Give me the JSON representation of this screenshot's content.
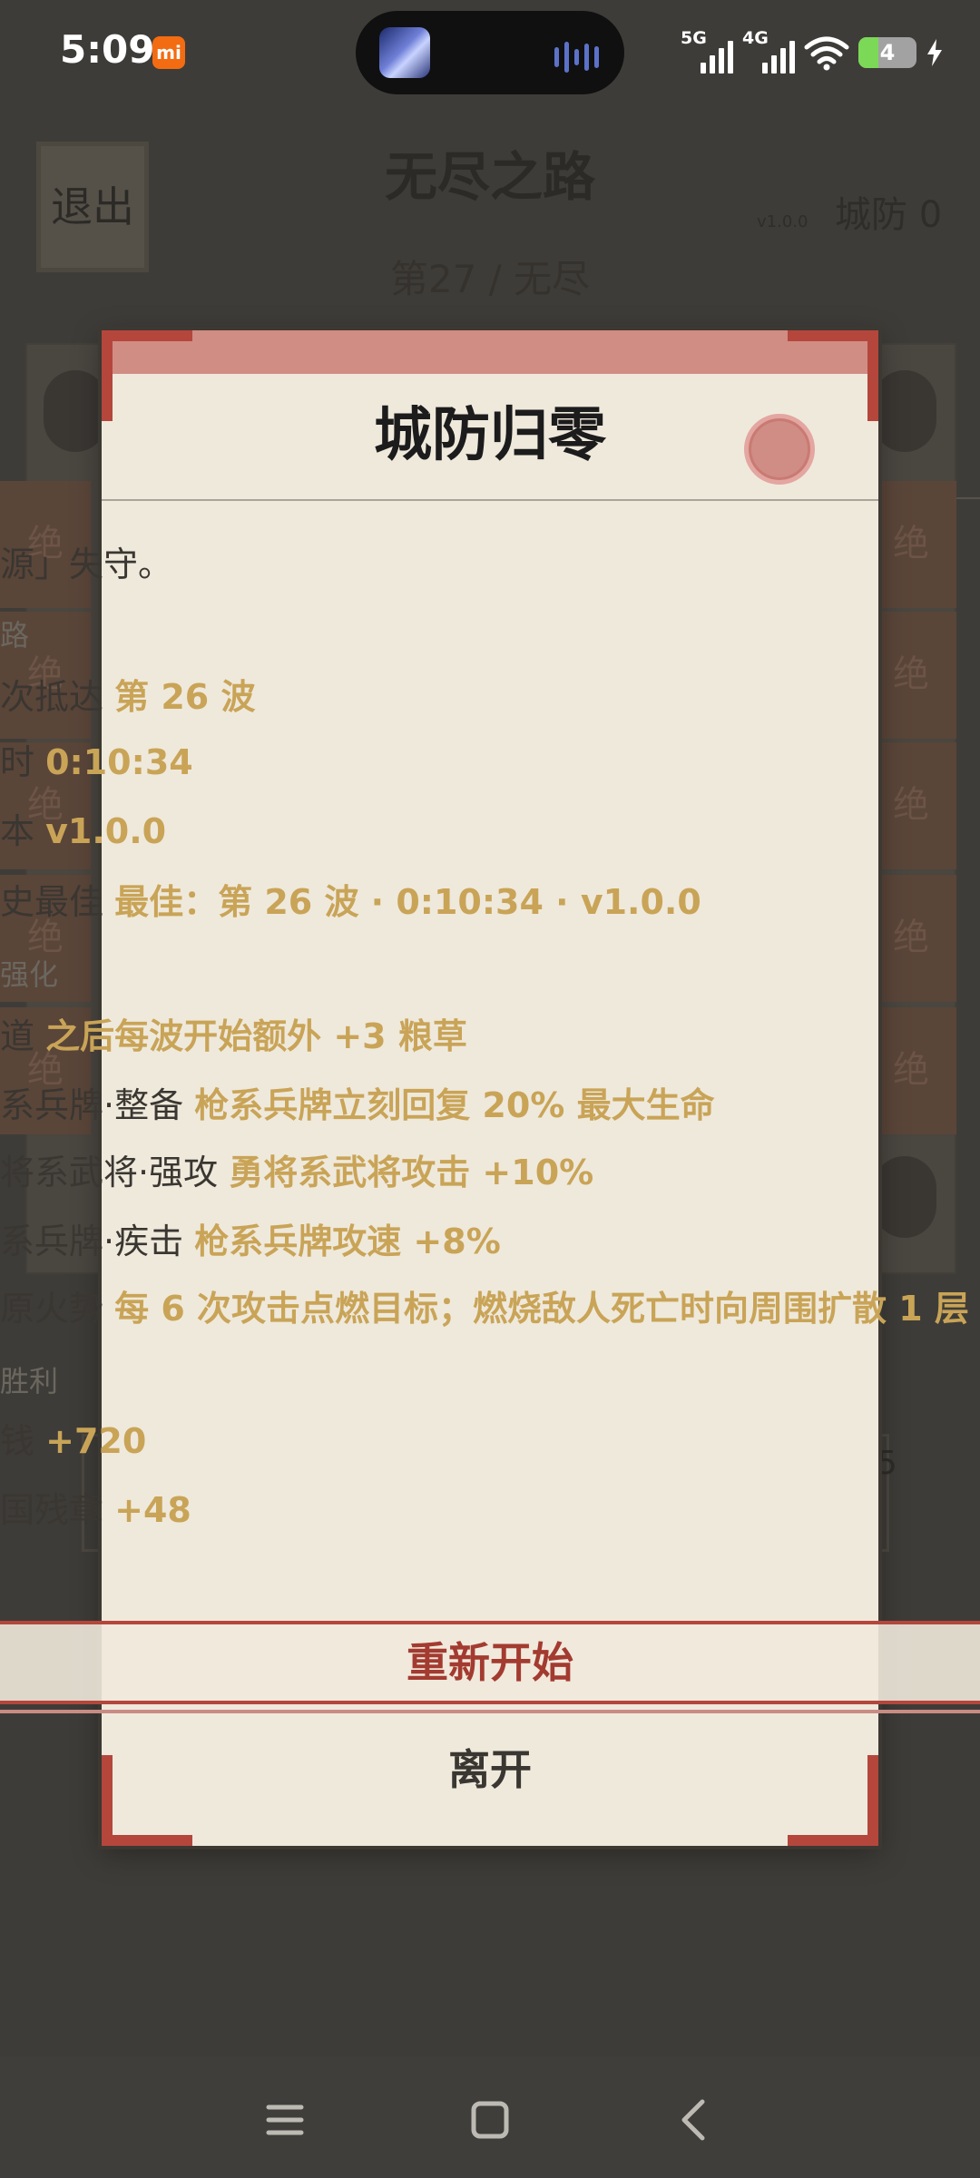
{
  "status_bar": {
    "time": "5:09",
    "mi_badge": "mi",
    "signal_1_label": "5G",
    "signal_2_label": "4G",
    "battery_level": "4"
  },
  "background": {
    "exit_label": "退出",
    "title": "无尽之路",
    "version": "v1.0.0",
    "defense": "城防 0",
    "wave": "第27 / 无尽",
    "strip_glyph": "绝",
    "side_number": "5"
  },
  "dialog": {
    "title": "城防归零",
    "message": "源」失守。",
    "section_route": "路",
    "rows_stats": [
      {
        "label": "次抵达",
        "value": "第 26 波"
      },
      {
        "label": "时",
        "value": "0:10:34"
      },
      {
        "label": "本",
        "value": "v1.0.0"
      },
      {
        "label": "史最佳",
        "value": "最佳：第 26 波 · 0:10:34 · v1.0.0"
      }
    ],
    "section_upgrades": "强化",
    "rows_upgrades": [
      {
        "label": "道",
        "value": "之后每波开始额外 +3 粮草"
      },
      {
        "label": "系兵牌·整备",
        "value": "枪系兵牌立刻回复 20% 最大生命"
      },
      {
        "label": "将系武将·强攻",
        "value": "勇将系武将攻击 +10%"
      },
      {
        "label": "系兵牌·疾击",
        "value": "枪系兵牌攻速 +8%"
      },
      {
        "label": "原火势",
        "value": "每 6 次攻击点燃目标；燃烧敌人死亡时向周围扩散 1 层"
      }
    ],
    "section_rewards": "胜利",
    "rows_rewards": [
      {
        "label": "钱",
        "value": "+720"
      },
      {
        "label": "国残章",
        "value": "+48"
      }
    ],
    "restart_label": "重新开始",
    "leave_label": "离开"
  },
  "colors": {
    "accent": "#b5463c",
    "value_gold": "#c9a457",
    "paper": "#efe9dc"
  }
}
